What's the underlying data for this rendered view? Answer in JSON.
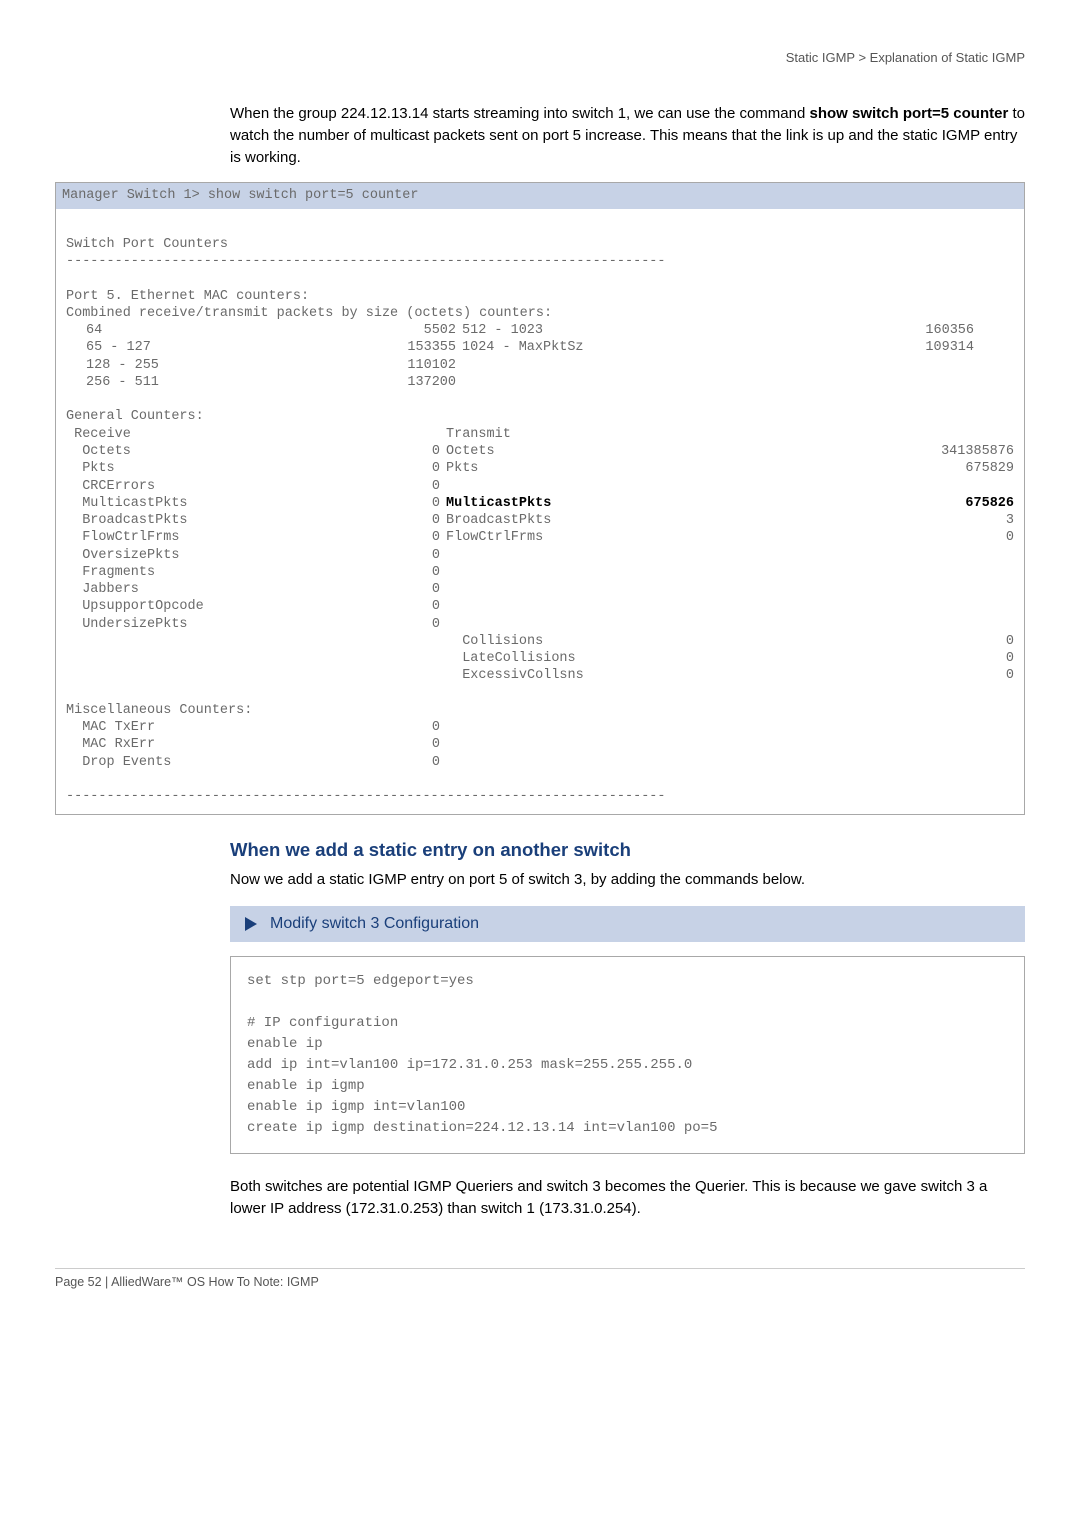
{
  "header": {
    "breadcrumb": "Static IGMP  >  Explanation of Static IGMP"
  },
  "intro": {
    "pre": "When the group 224.12.13.14 starts streaming into switch 1, we can use the command ",
    "cmd1": "show switch port=5 counter",
    "mid": " to watch the number of multicast packets sent on port 5 increase. This means that the link is up and the static IGMP entry is working."
  },
  "terminal": {
    "cmdline": "Manager Switch 1> show switch port=5 counter",
    "title": "Switch Port Counters",
    "rule": "--------------------------------------------------------------------------",
    "port_heading": "Port 5. Ethernet MAC counters:",
    "combined_heading": " Combined receive/transmit packets by size (octets) counters:",
    "size_rows": [
      {
        "l": "64",
        "lv": "5502",
        "r": "512 - 1023",
        "rv": "160356"
      },
      {
        "l": "65 - 127",
        "lv": "153355",
        "r": "1024 - MaxPktSz",
        "rv": "109314"
      },
      {
        "l": "128 - 255",
        "lv": "110102",
        "r": "",
        "rv": ""
      },
      {
        "l": "256 - 511",
        "lv": "137200",
        "r": "",
        "rv": ""
      }
    ],
    "general_heading": " General Counters:",
    "receive_label": " Receive",
    "transmit_label": "Transmit",
    "counter_rows": [
      {
        "l": "Octets",
        "lv": "0",
        "r": "Octets",
        "rv": "341385876",
        "bold": false
      },
      {
        "l": "Pkts",
        "lv": "0",
        "r": "Pkts",
        "rv": "675829",
        "bold": false
      },
      {
        "l": "CRCErrors",
        "lv": "0",
        "r": "",
        "rv": "",
        "bold": false
      },
      {
        "l": "MulticastPkts",
        "lv": "0",
        "r": "MulticastPkts",
        "rv": "675826",
        "bold": true
      },
      {
        "l": "BroadcastPkts",
        "lv": "0",
        "r": "BroadcastPkts",
        "rv": "3",
        "bold": false
      },
      {
        "l": "FlowCtrlFrms",
        "lv": "0",
        "r": "FlowCtrlFrms",
        "rv": "0",
        "bold": false
      },
      {
        "l": "OversizePkts",
        "lv": "0",
        "r": "",
        "rv": "",
        "bold": false
      },
      {
        "l": "Fragments",
        "lv": "0",
        "r": "",
        "rv": "",
        "bold": false
      },
      {
        "l": "Jabbers",
        "lv": "0",
        "r": "",
        "rv": "",
        "bold": false
      },
      {
        "l": "UpsupportOpcode",
        "lv": "0",
        "r": "",
        "rv": "",
        "bold": false
      },
      {
        "l": "UndersizePkts",
        "lv": "0",
        "r": "",
        "rv": "",
        "bold": false
      }
    ],
    "tx_only_rows": [
      {
        "r": "Collisions",
        "rv": "0"
      },
      {
        "r": "LateCollisions",
        "rv": "0"
      },
      {
        "r": "ExcessivCollsns",
        "rv": "0"
      }
    ],
    "misc_heading": " Miscellaneous Counters:",
    "misc_rows": [
      {
        "l": "MAC TxErr",
        "lv": "0"
      },
      {
        "l": "MAC RxErr",
        "lv": "0"
      },
      {
        "l": "Drop Events",
        "lv": "0"
      }
    ]
  },
  "section": {
    "heading": "When we add a static entry on another switch",
    "body1": "Now we add a static IGMP entry on port 5 of switch 3, by adding the commands below.",
    "modify_label": "Modify switch 3 Configuration",
    "code": "set stp port=5 edgeport=yes\n\n# IP configuration\nenable ip\nadd ip int=vlan100 ip=172.31.0.253 mask=255.255.255.0\nenable ip igmp\nenable ip igmp int=vlan100\ncreate ip igmp destination=224.12.13.14 int=vlan100 po=5",
    "body2": "Both switches are potential IGMP Queriers and switch 3 becomes the Querier. This is because we gave switch 3 a lower IP address (172.31.0.253) than switch 1 (173.31.0.254)."
  },
  "footer": {
    "text": "Page 52 | AlliedWare™ OS How To Note: IGMP"
  }
}
